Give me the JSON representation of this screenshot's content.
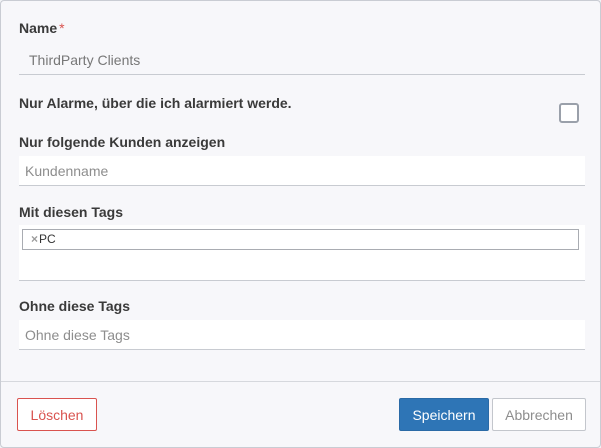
{
  "form": {
    "name_label": "Name",
    "required_marker": "*",
    "name_value": "ThirdParty Clients",
    "only_my_alarms_label": "Nur Alarme, über die ich alarmiert werde.",
    "only_my_alarms_checked": false,
    "customers_label": "Nur folgende Kunden anzeigen",
    "customers_placeholder": "Kundenname",
    "with_tags_label": "Mit diesen Tags",
    "with_tags": [
      {
        "remove": "×",
        "label": "PC"
      }
    ],
    "without_tags_label": "Ohne diese Tags",
    "without_tags_placeholder": "Ohne diese Tags"
  },
  "footer": {
    "delete_label": "Löschen",
    "save_label": "Speichern",
    "cancel_label": "Abbrechen"
  },
  "colors": {
    "primary": "#2e75b6",
    "danger": "#d9534f"
  }
}
